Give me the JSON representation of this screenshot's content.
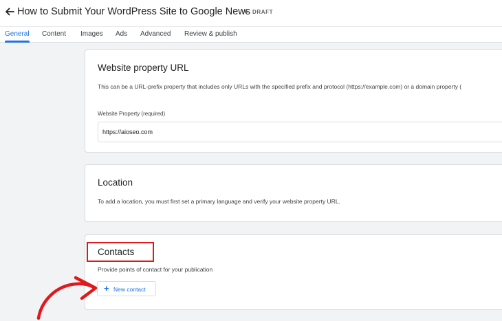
{
  "header": {
    "title": "How to Submit Your WordPress Site to Google News",
    "status": "DRAFT"
  },
  "tabs": [
    {
      "label": "General",
      "active": true
    },
    {
      "label": "Content",
      "active": false
    },
    {
      "label": "Images",
      "active": false
    },
    {
      "label": "Ads",
      "active": false
    },
    {
      "label": "Advanced",
      "active": false
    },
    {
      "label": "Review & publish",
      "active": false
    }
  ],
  "website_property": {
    "title": "Website property URL",
    "description": "This can be a URL-prefix property that includes only URLs with the specified prefix and protocol (https://example.com) or a domain property (",
    "field_label": "Website Property (required)",
    "field_value": "https://aioseo.com"
  },
  "location": {
    "title": "Location",
    "description": "To add a location, you must first set a primary language and verify your website property URL."
  },
  "contacts": {
    "title": "Contacts",
    "description": "Provide points of contact for your publication",
    "button_label": "New contact"
  },
  "colors": {
    "accent": "#1a73e8",
    "highlight": "#e0191e",
    "background": "#f1f3f4"
  },
  "icons": {
    "back": "arrow-left-icon",
    "add": "plus-icon",
    "annotation": "curved-arrow-icon"
  }
}
